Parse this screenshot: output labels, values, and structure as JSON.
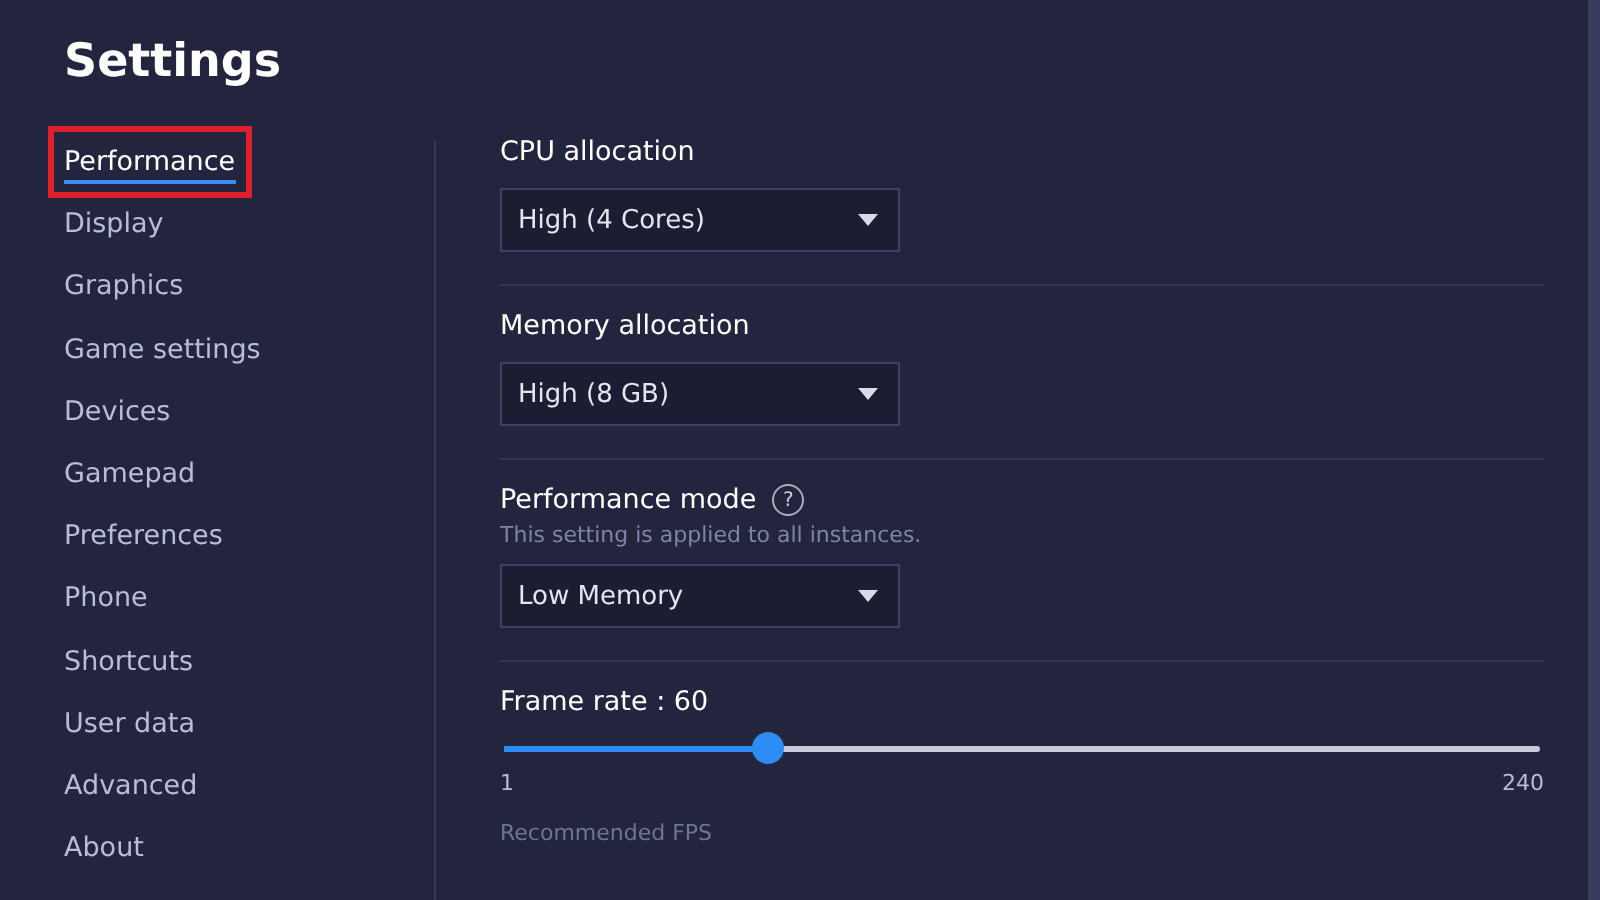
{
  "title": "Settings",
  "sidebar": {
    "items": [
      {
        "label": "Performance",
        "selected": true,
        "annotated": true
      },
      {
        "label": "Display",
        "selected": false,
        "annotated": false
      },
      {
        "label": "Graphics",
        "selected": false,
        "annotated": false
      },
      {
        "label": "Game settings",
        "selected": false,
        "annotated": false
      },
      {
        "label": "Devices",
        "selected": false,
        "annotated": false
      },
      {
        "label": "Gamepad",
        "selected": false,
        "annotated": false
      },
      {
        "label": "Preferences",
        "selected": false,
        "annotated": false
      },
      {
        "label": "Phone",
        "selected": false,
        "annotated": false
      },
      {
        "label": "Shortcuts",
        "selected": false,
        "annotated": false
      },
      {
        "label": "User data",
        "selected": false,
        "annotated": false
      },
      {
        "label": "Advanced",
        "selected": false,
        "annotated": false
      },
      {
        "label": "About",
        "selected": false,
        "annotated": false
      }
    ]
  },
  "sections": [
    {
      "kind": "dropdown",
      "label": "CPU allocation",
      "value": "High (4 Cores)"
    },
    {
      "kind": "dropdown",
      "label": "Memory allocation",
      "value": "High (8 GB)"
    },
    {
      "kind": "dropdown",
      "label": "Performance mode",
      "help": "?",
      "hint": "This setting is applied to all instances.",
      "value": "Low Memory"
    },
    {
      "kind": "slider",
      "label": "Frame rate : 60",
      "level": 0.255,
      "min": "1",
      "max": "240",
      "note": "Recommended FPS"
    }
  ]
}
